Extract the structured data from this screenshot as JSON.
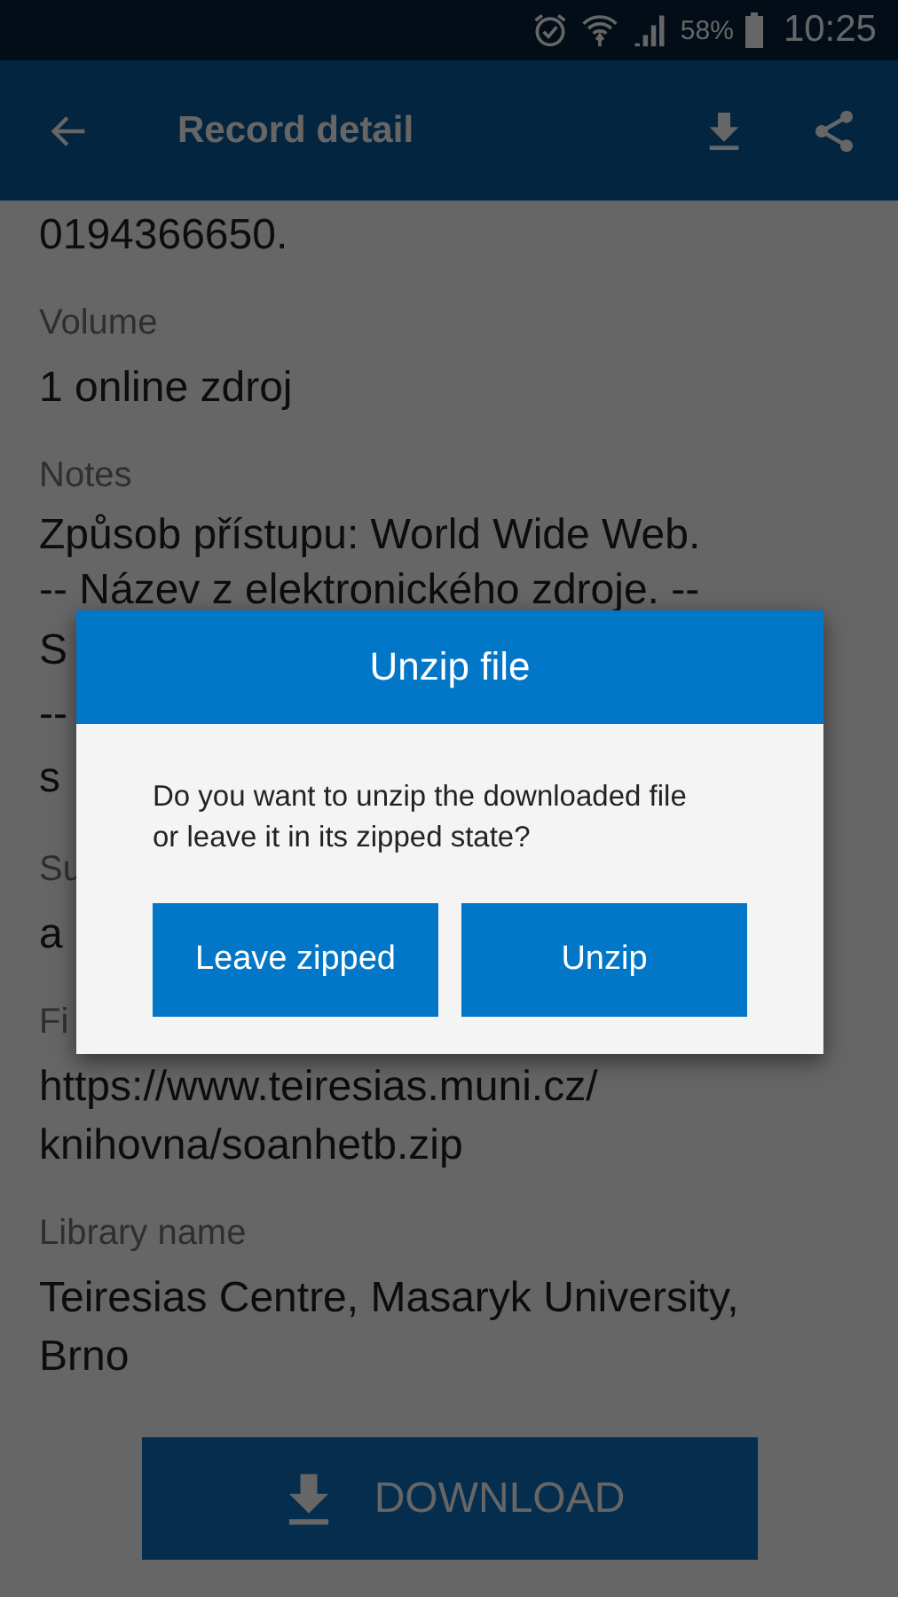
{
  "status_bar": {
    "battery": "58%",
    "time": "10:25"
  },
  "app_bar": {
    "title": "Record detail"
  },
  "fields": [
    {
      "lines": [
        "0194366650."
      ]
    },
    {
      "label": "Volume",
      "lines": [
        "1 online zdroj"
      ]
    },
    {
      "label": "Notes",
      "lines": [
        "Způsob přístupu: World Wide Web.",
        "-- Název z elektronického zdroje. --",
        "S",
        "--",
        "s"
      ]
    },
    {
      "label": "Su",
      "lines": [
        "a"
      ]
    },
    {
      "label": "Fi",
      "lines": [
        "https://www.teiresias.muni.cz/",
        "knihovna/soanhetb.zip"
      ]
    },
    {
      "label": "Library name",
      "lines": [
        "Teiresias Centre, Masaryk University,",
        "Brno"
      ]
    }
  ],
  "download_button": {
    "label": "DOWNLOAD"
  },
  "dialog": {
    "title": "Unzip file",
    "message": "Do you want to unzip the downloaded file or leave it in its zipped state?",
    "buttons": [
      "Leave zipped",
      "Unzip"
    ]
  }
}
